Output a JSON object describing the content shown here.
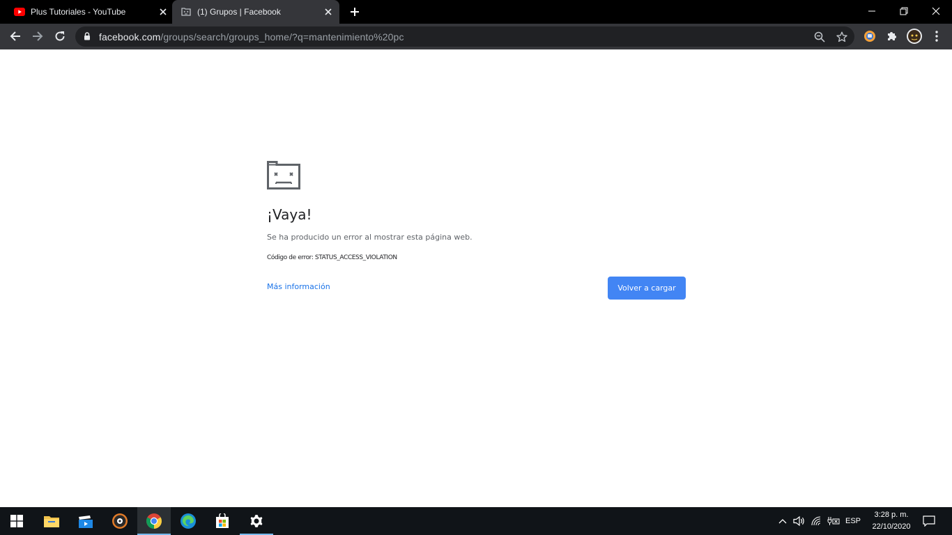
{
  "browser": {
    "tabs": [
      {
        "title": "Plus Tutoriales - YouTube",
        "favicon": "youtube-icon",
        "active": false
      },
      {
        "title": "(1) Grupos | Facebook",
        "favicon": "sad-tab-icon",
        "active": true
      }
    ],
    "url_host": "facebook.com",
    "url_path": "/groups/search/groups_home/?q=mantenimiento%20pc"
  },
  "error_page": {
    "heading": "¡Vaya!",
    "message": "Se ha producido un error al mostrar esta página web.",
    "error_code": "Código de error: STATUS_ACCESS_VIOLATION",
    "more_info_link": "Más información",
    "reload_button": "Volver a cargar"
  },
  "taskbar": {
    "apps": [
      "start-icon",
      "file-explorer-icon",
      "movies-tv-icon",
      "groove-music-icon",
      "chrome-icon",
      "edge-icon",
      "store-icon",
      "settings-icon"
    ],
    "language": "ESP",
    "time": "3:28 p. m.",
    "date": "22/10/2020"
  },
  "colors": {
    "accent": "#4285f4",
    "link": "#1a73e8",
    "tab_active_bg": "#35363a",
    "taskbar_bg": "#101418"
  }
}
